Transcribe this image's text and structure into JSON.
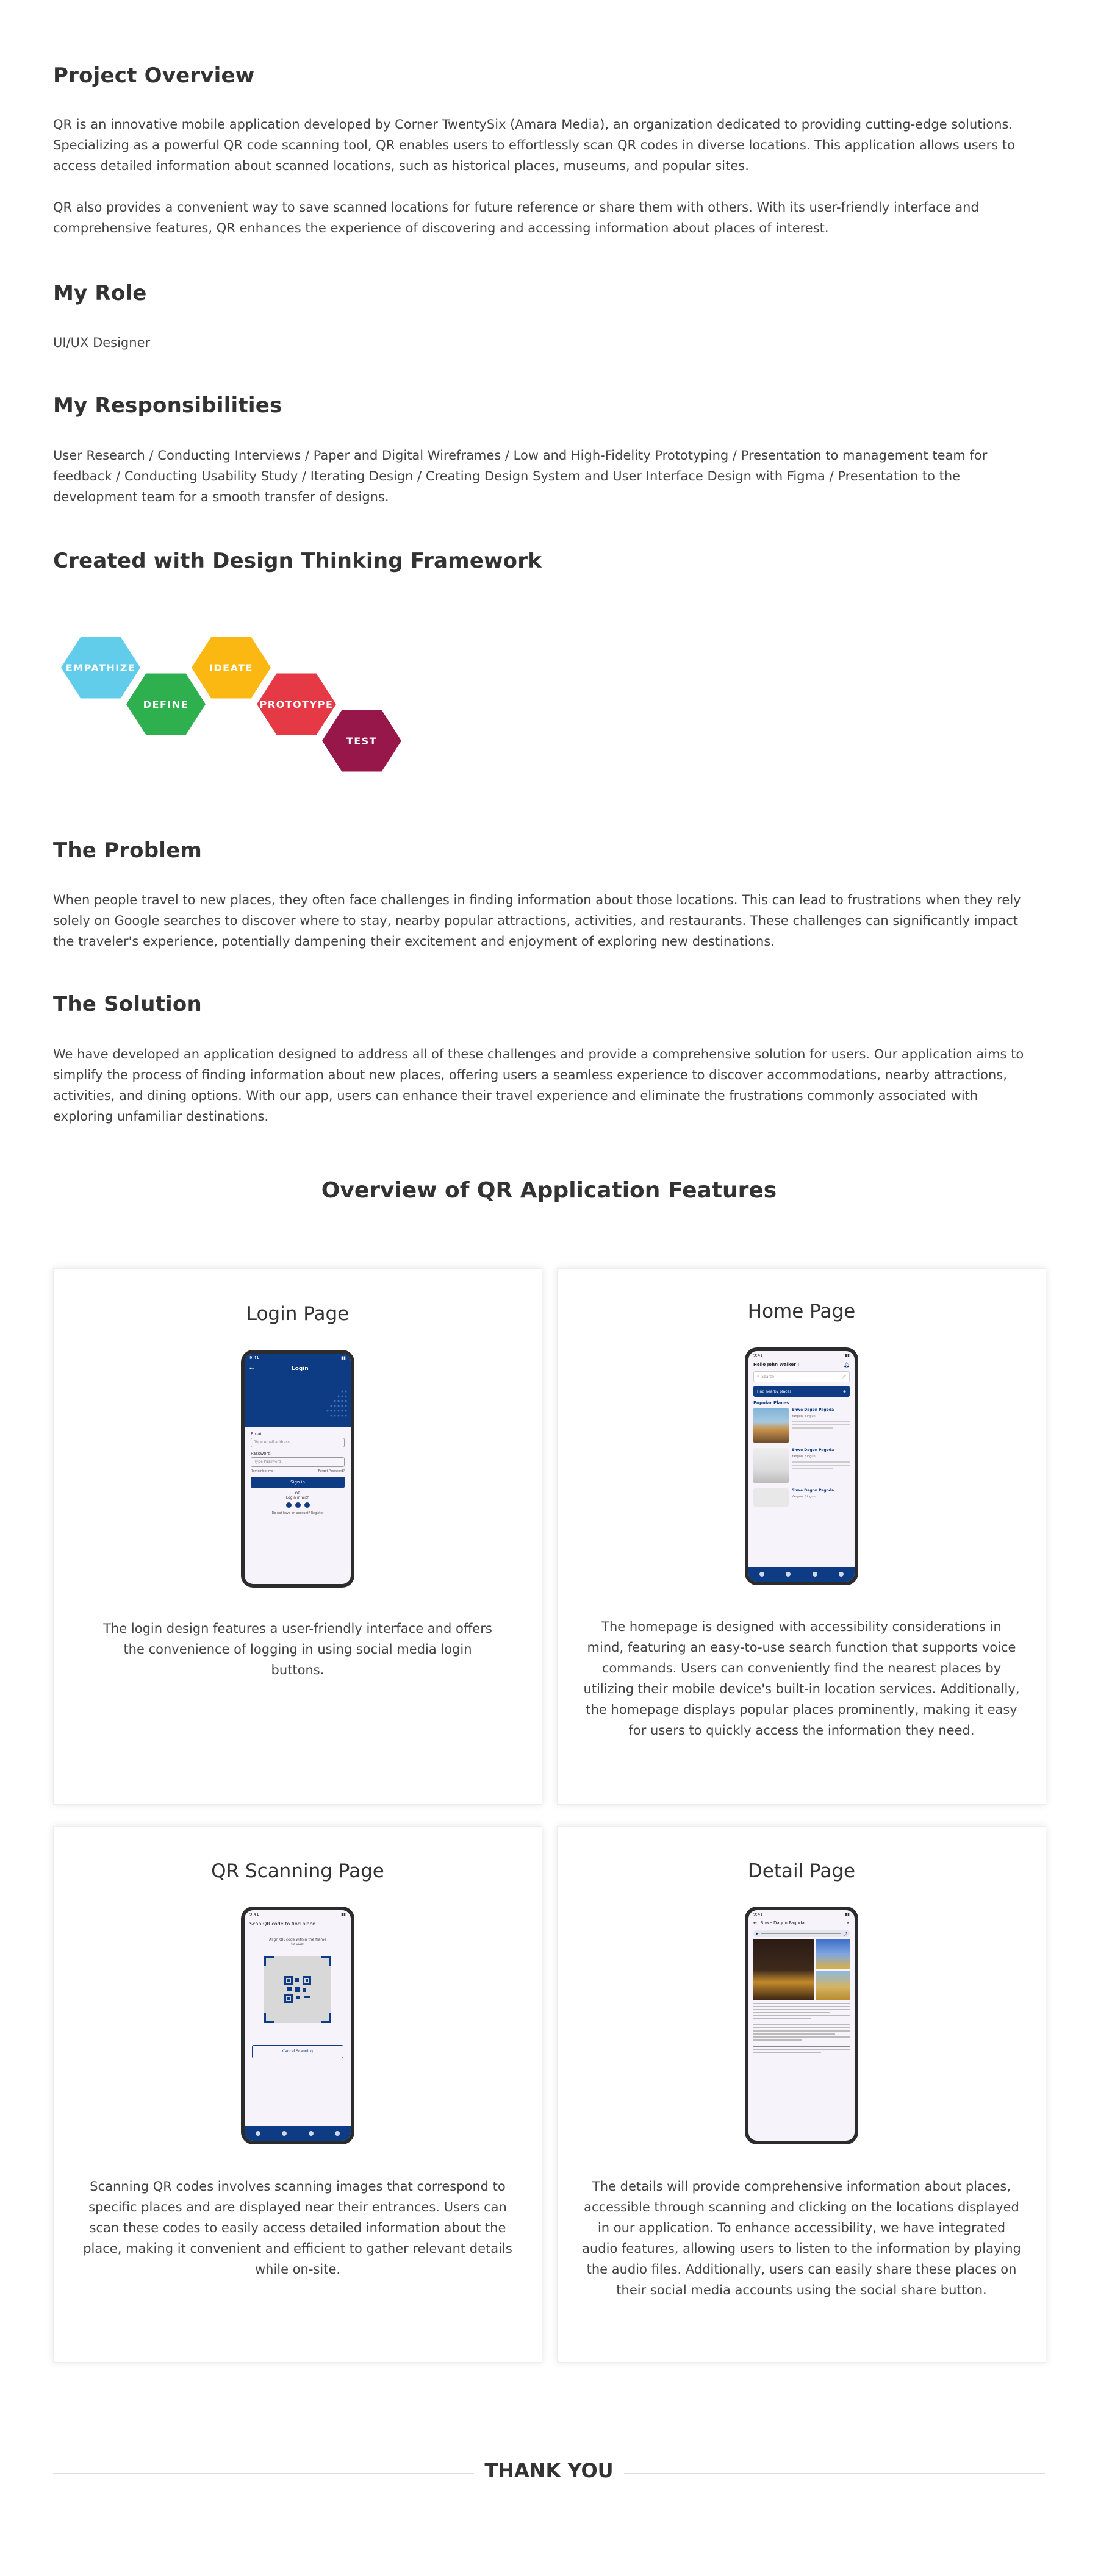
{
  "project_overview": {
    "title": "Project Overview",
    "p1": "QR is an innovative mobile application developed by Corner TwentySix (Amara Media), an organization dedicated to providing cutting-edge solutions. Specializing as a powerful QR code scanning tool, QR enables users to effortlessly scan QR codes in diverse locations. This application allows users to access detailed information about scanned locations, such as historical places, museums, and popular sites.",
    "p2": "QR also provides a convenient way to save scanned locations for future reference or share them with others. With its user-friendly interface and comprehensive features, QR enhances the experience of discovering and accessing information about places of interest."
  },
  "my_role": {
    "title": "My Role",
    "text": "UI/UX Designer"
  },
  "responsibilities": {
    "title": "My Responsibilities",
    "text": "User Research / Conducting Interviews / Paper and Digital Wireframes / Low and High-Fidelity Prototyping / Presentation to management team for feedback / Conducting Usability Study / Iterating Design / Creating Design System and User Interface Design with Figma / Presentation to the development team for a smooth transfer of designs."
  },
  "design_thinking": {
    "title": "Created with Design Thinking Framework",
    "stages": [
      {
        "label": "EMPATHIZE",
        "color": "#62cdeb"
      },
      {
        "label": "DEFINE",
        "color": "#2eb04e"
      },
      {
        "label": "IDEATE",
        "color": "#fbb813"
      },
      {
        "label": "PROTOTYPE",
        "color": "#e63946"
      },
      {
        "label": "TEST",
        "color": "#97174a"
      }
    ]
  },
  "problem": {
    "title": "The Problem",
    "text": "When people travel to new places, they often face challenges in finding information about those locations. This can lead to frustrations when they rely solely on Google searches to discover where to stay, nearby popular attractions, activities, and restaurants. These challenges can significantly impact the traveler's experience, potentially dampening their excitement and enjoyment of exploring new destinations."
  },
  "solution": {
    "title": "The Solution",
    "text": "We have developed an application designed to address all of these challenges and provide a comprehensive solution for users. Our application aims to simplify the process of finding information about new places, offering users a seamless experience to discover accommodations, nearby attractions, activities, and dining options. With our app, users can enhance their travel experience and eliminate the frustrations commonly associated with exploring unfamiliar destinations."
  },
  "features": {
    "title": "Overview of QR Application Features",
    "cards": [
      {
        "title": "Login Page",
        "text": "The login design features a user-friendly interface and offers the convenience of logging in using social media login buttons.",
        "screen": {
          "time": "9:41",
          "header": "Login",
          "email_label": "Email",
          "email_placeholder": "Type email address",
          "password_label": "Password",
          "password_placeholder": "Type Password",
          "remember": "Remember me",
          "forgot": "Forgot Password?",
          "signin": "Sign in",
          "or": "OR",
          "login_with": "Login in with",
          "signup": "Do not have an account? Register"
        }
      },
      {
        "title": "Home Page",
        "text": "The homepage is designed with accessibility considerations in mind, featuring an easy-to-use search function that supports voice commands. Users can conveniently find the nearest places by utilizing their mobile device's built-in location services. Additionally, the homepage displays popular places prominently, making it easy for users to quickly access the information they need.",
        "screen": {
          "time": "9:41",
          "greeting": "Hello John Walker !",
          "search": "Search",
          "nearby": "Find nearby places",
          "popular": "Popular Places",
          "places": [
            {
              "name": "Shwe Dagon Pagoda",
              "loc": "Yangon, Bingun"
            },
            {
              "name": "Shwe Dagon Pagoda",
              "loc": "Yangon, Bingun"
            },
            {
              "name": "Shwe Dagon Pagoda",
              "loc": "Yangon, Bingun"
            }
          ]
        }
      },
      {
        "title": "QR Scanning Page",
        "text": "Scanning QR codes involves scanning images that correspond to specific places and are displayed near their entrances. Users can scan these codes to easily access detailed information about the place, making it convenient and efficient to gather relevant details while on-site.",
        "screen": {
          "time": "9:41",
          "header": "Scan QR code to find place",
          "hint": "Align QR code within the frame to scan",
          "cancel": "Cancel Scanning"
        }
      },
      {
        "title": "Detail Page",
        "text": "The details will provide comprehensive information about places, accessible through scanning and clicking on the locations displayed in our application. To enhance accessibility, we have integrated audio features, allowing users to listen to the information by playing the audio files. Additionally, users can easily share these places on their social media accounts using the social share button.",
        "screen": {
          "time": "9:41",
          "header": "Shwe Dagon Pagoda"
        }
      }
    ]
  },
  "thanks": "THANK YOU"
}
